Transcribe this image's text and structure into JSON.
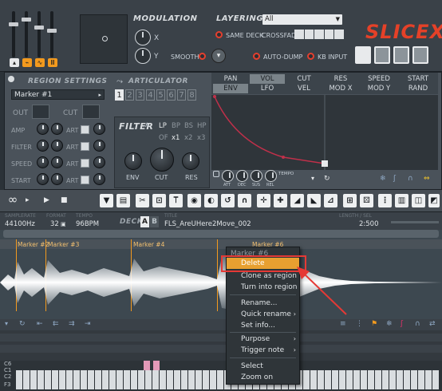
{
  "modulation": {
    "title": "MODULATION",
    "x_label": "X",
    "y_label": "Y",
    "smooth_label": "SMOOTH"
  },
  "layering": {
    "title": "LAYERING",
    "select_value": "All",
    "same_deck_label": "SAME DECK",
    "crossfade_label": "CROSSFADE",
    "auto_dump_label": "AUTO-DUMP",
    "kb_input_label": "KB INPUT"
  },
  "logo": "SLICEX",
  "region_settings": {
    "title": "REGION SETTINGS",
    "marker_value": "Marker #1",
    "out_label": "OUT",
    "cut_label": "CUT",
    "rows": [
      "AMP",
      "FILTER",
      "SPEED",
      "START"
    ],
    "art_label": "ART"
  },
  "articulator": {
    "title": "ARTICULATOR",
    "numbers": [
      "1",
      "2",
      "3",
      "4",
      "5",
      "6",
      "7",
      "8"
    ]
  },
  "filter": {
    "title": "FILTER",
    "modes_row1": [
      "LP",
      "BP",
      "BS",
      "HP"
    ],
    "modes_row2": [
      "OF",
      "x1",
      "x2",
      "x3"
    ],
    "knobs": [
      "ENV",
      "CUT",
      "RES"
    ]
  },
  "envelope": {
    "tabs_row1": [
      "PAN",
      "VOL",
      "CUT",
      "RES",
      "SPEED",
      "START"
    ],
    "tabs_row2": [
      "ENV",
      "LFO",
      "VEL",
      "MOD X",
      "MOD Y",
      "RAND"
    ],
    "adsr": [
      "ATT",
      "DEC",
      "SUS",
      "REL"
    ],
    "tempo_label": "TEMPO"
  },
  "info": {
    "samplerate_label": "SAMPLERATE",
    "samplerate": "44100Hz",
    "format_label": "FORMAT",
    "format": "32",
    "tempo_label": "TEMPO",
    "tempo": "96BPM",
    "deck_label": "DECK",
    "deck_a": "A",
    "deck_b": "B",
    "title_label": "TITLE",
    "title": "FLS_AreUHere2Move_002",
    "length_label": "LENGTH / SEL",
    "length": "2:500"
  },
  "markers": [
    "Marker #2",
    "Marker #3",
    "Marker #4",
    "Marker #6"
  ],
  "piano": {
    "labels": [
      "C6",
      "C1",
      "C2",
      "F3"
    ]
  },
  "context_menu": {
    "header": "Marker #6",
    "items": [
      {
        "label": "Delete",
        "submenu": false
      },
      {
        "label": "Clone as region",
        "submenu": false
      },
      {
        "label": "Turn into region",
        "submenu": false
      },
      {
        "label": "Rename...",
        "submenu": false
      },
      {
        "label": "Quick rename",
        "submenu": true
      },
      {
        "label": "Set info...",
        "submenu": false
      },
      {
        "label": "Purpose",
        "submenu": true
      },
      {
        "label": "Trigger note",
        "submenu": true
      },
      {
        "label": "Select",
        "submenu": false
      },
      {
        "label": "Zoom on",
        "submenu": false
      }
    ]
  },
  "colors": {
    "accent_orange": "#f39a1e",
    "highlight_red": "#e53935",
    "menu_highlight": "#e8a030",
    "envelope_line": "#c0304a"
  }
}
